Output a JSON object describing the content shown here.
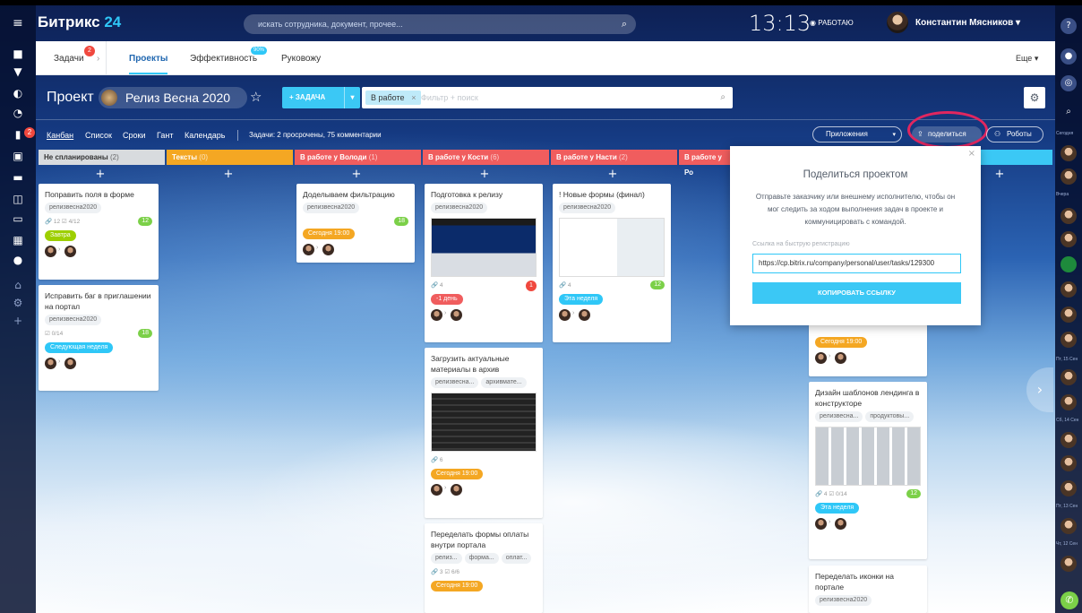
{
  "header": {
    "logo_text": "Битрикс",
    "logo_num": "24",
    "search_placeholder": "искать сотрудника, документ, прочее...",
    "time": "13:13",
    "status": "◉ РАБОТАЮ",
    "user_name": "Константин Мясников  ▾"
  },
  "nav": {
    "tasks": "Задачи",
    "tasks_badge": "2",
    "projects": "Проекты",
    "efficiency": "Эффективность",
    "efficiency_badge": "90%",
    "manage": "Руковожу",
    "more": "Еще ▾"
  },
  "project": {
    "label": "Проект",
    "name": "Релиз Весна 2020",
    "add_task": "+  ЗАДАЧА",
    "filter_tag": "В работе",
    "filter_placeholder": "Фильтр + поиск"
  },
  "views": {
    "kanban": "Канбан",
    "list": "Список",
    "deadlines": "Сроки",
    "gantt": "Гант",
    "calendar": "Календарь",
    "info": "Задачи: 2 просрочены,  75 комментарии",
    "apps": "Приложения",
    "share": "поделиться",
    "robots": "Роботы"
  },
  "columns": [
    {
      "title": "Не спланированы",
      "count": "(2)",
      "color": "#d8dbde"
    },
    {
      "title": "Тексты",
      "count": "(0)",
      "color": "#f4a723"
    },
    {
      "title": "В работе у Володи",
      "count": "(1)",
      "color": "#f05d5e"
    },
    {
      "title": "В работе у Кости",
      "count": "(6)",
      "color": "#f05d5e"
    },
    {
      "title": "В работе у Насти",
      "count": "(2)",
      "color": "#f05d5e"
    },
    {
      "title": "В работе у Ро",
      "count": "",
      "color": "#f05d5e"
    }
  ],
  "cards": {
    "c1": {
      "title": "Поправить поля в форме",
      "tag": "релизвесна2020",
      "meta": "🔗 12   ☑ 4/12",
      "count": "12",
      "deadline": "Завтра"
    },
    "c2": {
      "title": "Исправить баг в приглашении на портал",
      "tag": "релизвесна2020",
      "meta": "☑ 0/14",
      "count": "18",
      "deadline": "Следующая неделя"
    },
    "c3": {
      "title": "Доделываем фильтрацию",
      "tag": "релизвесна2020",
      "deadline": "Сегодня 19:00",
      "count": "18"
    },
    "c4": {
      "title": "Подготовка к релизу",
      "tag": "релизвесна2020",
      "meta": "🔗 4",
      "count": "1",
      "deadline": "-1 день"
    },
    "c5": {
      "title": "! Новые формы (финал)",
      "tag": "релизвесна2020",
      "meta": "🔗 4",
      "count": "12",
      "deadline": "Эта неделя"
    },
    "c6": {
      "title": "Загрузить актуальные материалы в архив",
      "tag1": "релизвесна...",
      "tag2": "архивмате...",
      "meta": "🔗 6",
      "deadline": "Сегодня 19:00"
    },
    "c7": {
      "title": "Переделать формы оплаты внутри портала",
      "tag1": "релиз...",
      "tag2": "форма...",
      "tag3": "оплат...",
      "meta": "🔗 3   ☑ 6/6",
      "deadline": "Сегодня 19:00"
    },
    "c8": {
      "deadline": "Сегодня 19:00"
    },
    "c9": {
      "title": "Дизайн шаблонов лендинга в конструкторе",
      "tag1": "релизвесна...",
      "tag2": "продуктовы...",
      "meta": "🔗 4   ☑ 0/14",
      "count": "12",
      "deadline": "Эта неделя"
    },
    "c10": {
      "title": "Переделать иконки на портале",
      "tag": "релизвесна2020"
    }
  },
  "popup": {
    "title": "Поделиться проектом",
    "description": "Отправьте заказчику или внешнему исполнителю, чтобы он мог следить за ходом выполнения задач в проекте и коммуницировать с командой.",
    "link_label": "Ссылка на быструю регистрацию",
    "link_value": "https://cp.bitrix.ru/company/personal/user/tasks/129300",
    "copy_button": "КОПИРОВАТЬ ССЫЛКУ"
  },
  "right_rail": {
    "d1": "Сегодня",
    "d2": "Вчера",
    "d3": "Пт, 15 Сен",
    "d4": "Сб, 14 Сен",
    "d5": "Пт, 13 Сен",
    "d6": "Чт, 12 Сен"
  }
}
